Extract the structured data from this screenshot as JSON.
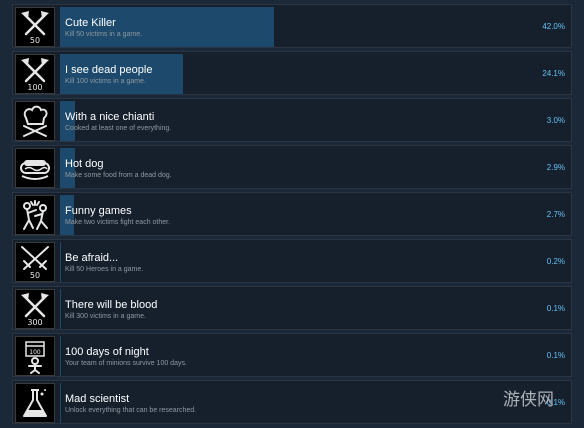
{
  "achievements": [
    {
      "title": "Cute Killer",
      "description": "Kill 50 victims in a game.",
      "percent_label": "42.0%",
      "percent": 42.0,
      "icon": "crossed-axes-50-icon"
    },
    {
      "title": "I see dead people",
      "description": "Kill 100 victims in a game.",
      "percent_label": "24.1%",
      "percent": 24.1,
      "icon": "crossed-axes-100-icon"
    },
    {
      "title": "With a nice chianti",
      "description": "Cooked at least one of everything.",
      "percent_label": "3.0%",
      "percent": 3.0,
      "icon": "chef-hat-icon"
    },
    {
      "title": "Hot dog",
      "description": "Make some food from a dead dog.",
      "percent_label": "2.9%",
      "percent": 2.9,
      "icon": "hot-dog-icon"
    },
    {
      "title": "Funny games",
      "description": "Make two victims fight each other.",
      "percent_label": "2.7%",
      "percent": 2.7,
      "icon": "fighting-figures-icon"
    },
    {
      "title": "Be afraid...",
      "description": "Kill 50 Heroes in a game.",
      "percent_label": "0.2%",
      "percent": 0.2,
      "icon": "crossed-swords-50-icon"
    },
    {
      "title": "There will be blood",
      "description": "Kill 300 victims in a game.",
      "percent_label": "0.1%",
      "percent": 0.1,
      "icon": "crossed-axes-300-icon"
    },
    {
      "title": "100 days of night",
      "description": "Your team of minions survive 100 days.",
      "percent_label": "0.1%",
      "percent": 0.1,
      "icon": "calendar-100-icon"
    },
    {
      "title": "Mad scientist",
      "description": "Unlock everything that can be researched.",
      "percent_label": "0.1%",
      "percent": 0.1,
      "icon": "flask-icon"
    }
  ],
  "watermark": "游侠网",
  "colors": {
    "background": "#1b2838",
    "row": "#16202d",
    "bar": "#1d4a6c",
    "title": "#ffffff",
    "description": "#8f98a0",
    "percent": "#66c0f4"
  }
}
